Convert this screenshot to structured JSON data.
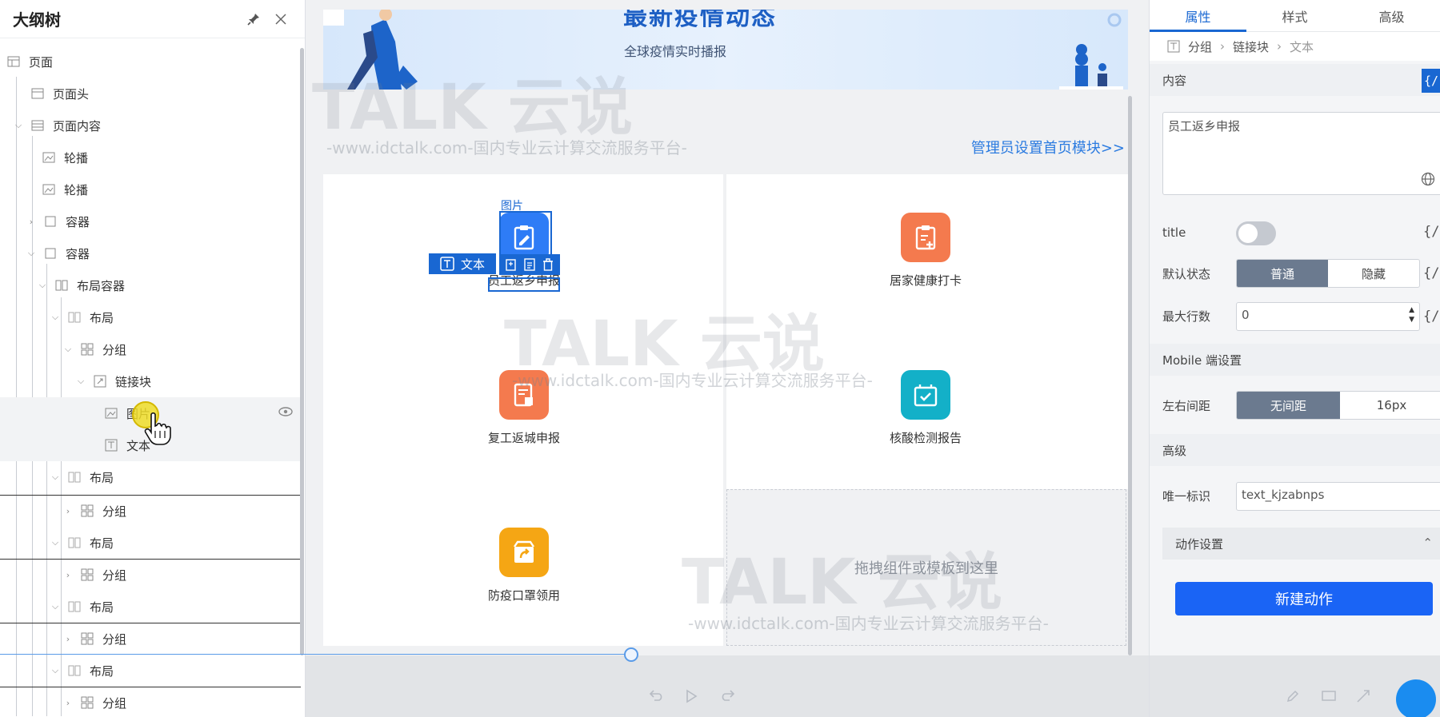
{
  "outline": {
    "title": "大纲树",
    "items": [
      {
        "label": "页面"
      },
      {
        "label": "页面头"
      },
      {
        "label": "页面内容"
      },
      {
        "label": "轮播"
      },
      {
        "label": "轮播"
      },
      {
        "label": "容器"
      },
      {
        "label": "容器"
      },
      {
        "label": "布局容器"
      },
      {
        "label": "布局"
      },
      {
        "label": "分组"
      },
      {
        "label": "链接块"
      },
      {
        "label": "图片"
      },
      {
        "label": "文本"
      },
      {
        "label": "布局"
      },
      {
        "label": "分组"
      },
      {
        "label": "布局"
      },
      {
        "label": "分组"
      },
      {
        "label": "布局"
      },
      {
        "label": "分组"
      },
      {
        "label": "布局"
      },
      {
        "label": "分组"
      }
    ]
  },
  "canvas": {
    "banner_title": "最新疫情动态",
    "banner_subtitle": "全球疫情实时播报",
    "admin_link": "管理员设置首页模块>>",
    "selected_image_label": "图片",
    "selected_text_chip": "文本",
    "tiles": [
      {
        "label": "员工返乡申报",
        "color": "#2e7cf6"
      },
      {
        "label": "居家健康打卡",
        "color": "#f47a4e"
      },
      {
        "label": "复工返城申报",
        "color": "#f47a4e"
      },
      {
        "label": "核酸检测报告",
        "color": "#13b0c8"
      },
      {
        "label": "防疫口罩领用",
        "color": "#f5a614"
      }
    ],
    "drop_zone": "拖拽组件或模板到这里",
    "watermark_logo": "TALK 云说",
    "watermark_url": "-www.idctalk.com-国内专业云计算交流服务平台-"
  },
  "props": {
    "tabs": [
      "属性",
      "样式",
      "高级"
    ],
    "breadcrumb": [
      "分组",
      "链接块",
      "文本"
    ],
    "content_section": "内容",
    "content_value": "员工返乡申报",
    "title_label": "title",
    "default_state_label": "默认状态",
    "default_state_options": [
      "普通",
      "隐藏"
    ],
    "max_lines_label": "最大行数",
    "max_lines_value": "0",
    "mobile_section": "Mobile 端设置",
    "lr_spacing_label": "左右间距",
    "lr_spacing_options": [
      "无间距",
      "16px"
    ],
    "advanced_section": "高级",
    "unique_id_label": "唯一标识",
    "unique_id_value": "text_kjzabnps",
    "action_section": "动作设置",
    "new_action_button": "新建动作",
    "code_icon_text": "{/"
  },
  "colors": {
    "accent": "#1967d2",
    "primary_button": "#1a64f5",
    "segment_active": "#6b7a8f"
  }
}
